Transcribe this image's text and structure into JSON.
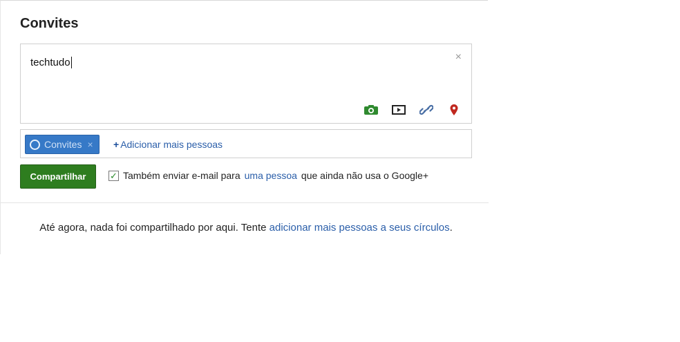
{
  "section": {
    "title": "Convites"
  },
  "composer": {
    "text": "techtudo",
    "close_glyph": "×",
    "attachments": [
      {
        "icon": "camera-icon",
        "color": "#2f8a2f"
      },
      {
        "icon": "video-icon",
        "color": "#222222"
      },
      {
        "icon": "link-icon",
        "color": "#4a6fa5"
      },
      {
        "icon": "location-pin-icon",
        "color": "#c0281f"
      }
    ]
  },
  "share": {
    "chip_label": "Convites",
    "chip_remove": "×",
    "add_more_plus": "+",
    "add_more_label": "Adicionar mais pessoas"
  },
  "actions": {
    "share_button": "Compartilhar",
    "email_checked": true,
    "email_text_before": "Também enviar e-mail para",
    "email_link": "uma pessoa",
    "email_text_after": "que ainda não usa o Google+"
  },
  "empty_state": {
    "text_before": "Até agora, nada foi compartilhado por aqui. Tente",
    "link": "adicionar mais pessoas a seus círculos",
    "text_after": "."
  },
  "colors": {
    "share_button": "#2e7d1f",
    "chip": "#3679c7",
    "link": "#2a5ea9"
  }
}
